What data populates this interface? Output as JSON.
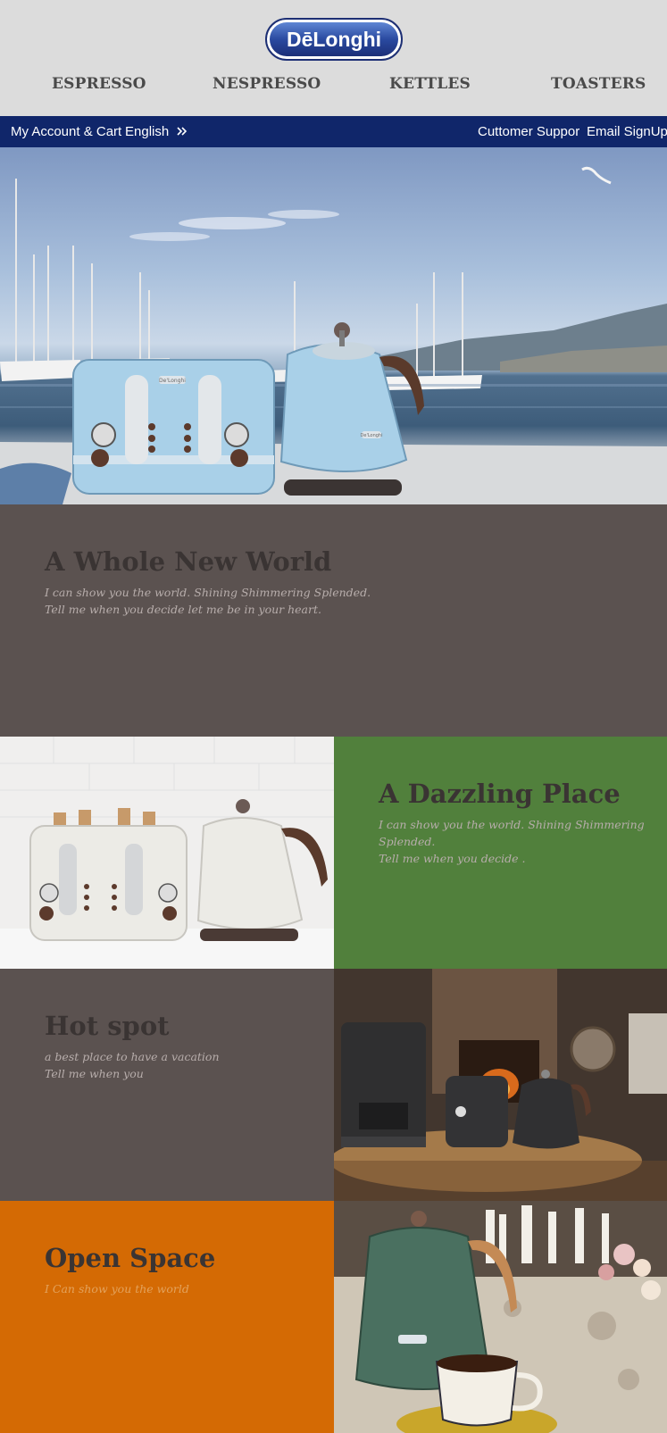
{
  "brand": {
    "logo_text": "DēLonghi"
  },
  "nav": {
    "items": [
      {
        "label": "ESPRESSO"
      },
      {
        "label": "NESPRESSO"
      },
      {
        "label": "KETTLES"
      },
      {
        "label": "TOASTERS"
      }
    ]
  },
  "utility": {
    "account": "My Account & Cart",
    "language": "English",
    "language_icon": "double-chevron-right-icon",
    "support": "Cuttomer Suppor",
    "signup": "Email SignUp"
  },
  "hero": {
    "toaster_badge": "De'Longhi",
    "kettle_badge": "De'Longhi"
  },
  "sections": [
    {
      "title": "A Whole New World",
      "sub1": "I can show you the world. Shining Shimmering Splended.",
      "sub2": "Tell me when you decide let me be in your heart.",
      "bg": "#5b5250"
    },
    {
      "title": "A Dazzling Place",
      "sub1": "I can show you the world. Shining Shimmering Splended.",
      "sub2": "Tell me when you decide .",
      "bg": "#51803c"
    },
    {
      "title": "Hot spot",
      "sub1": "a best place to have a vacation",
      "sub2": "Tell me when you",
      "bg": "#5b5250"
    },
    {
      "title": "Open Space",
      "sub1": "I Can show you the world",
      "sub2": "",
      "bg": "#d46a04"
    }
  ],
  "colors": {
    "header_bg": "#dcdcdc",
    "utility_bg": "#10266a",
    "logo_blue": "#2a4aa0"
  }
}
